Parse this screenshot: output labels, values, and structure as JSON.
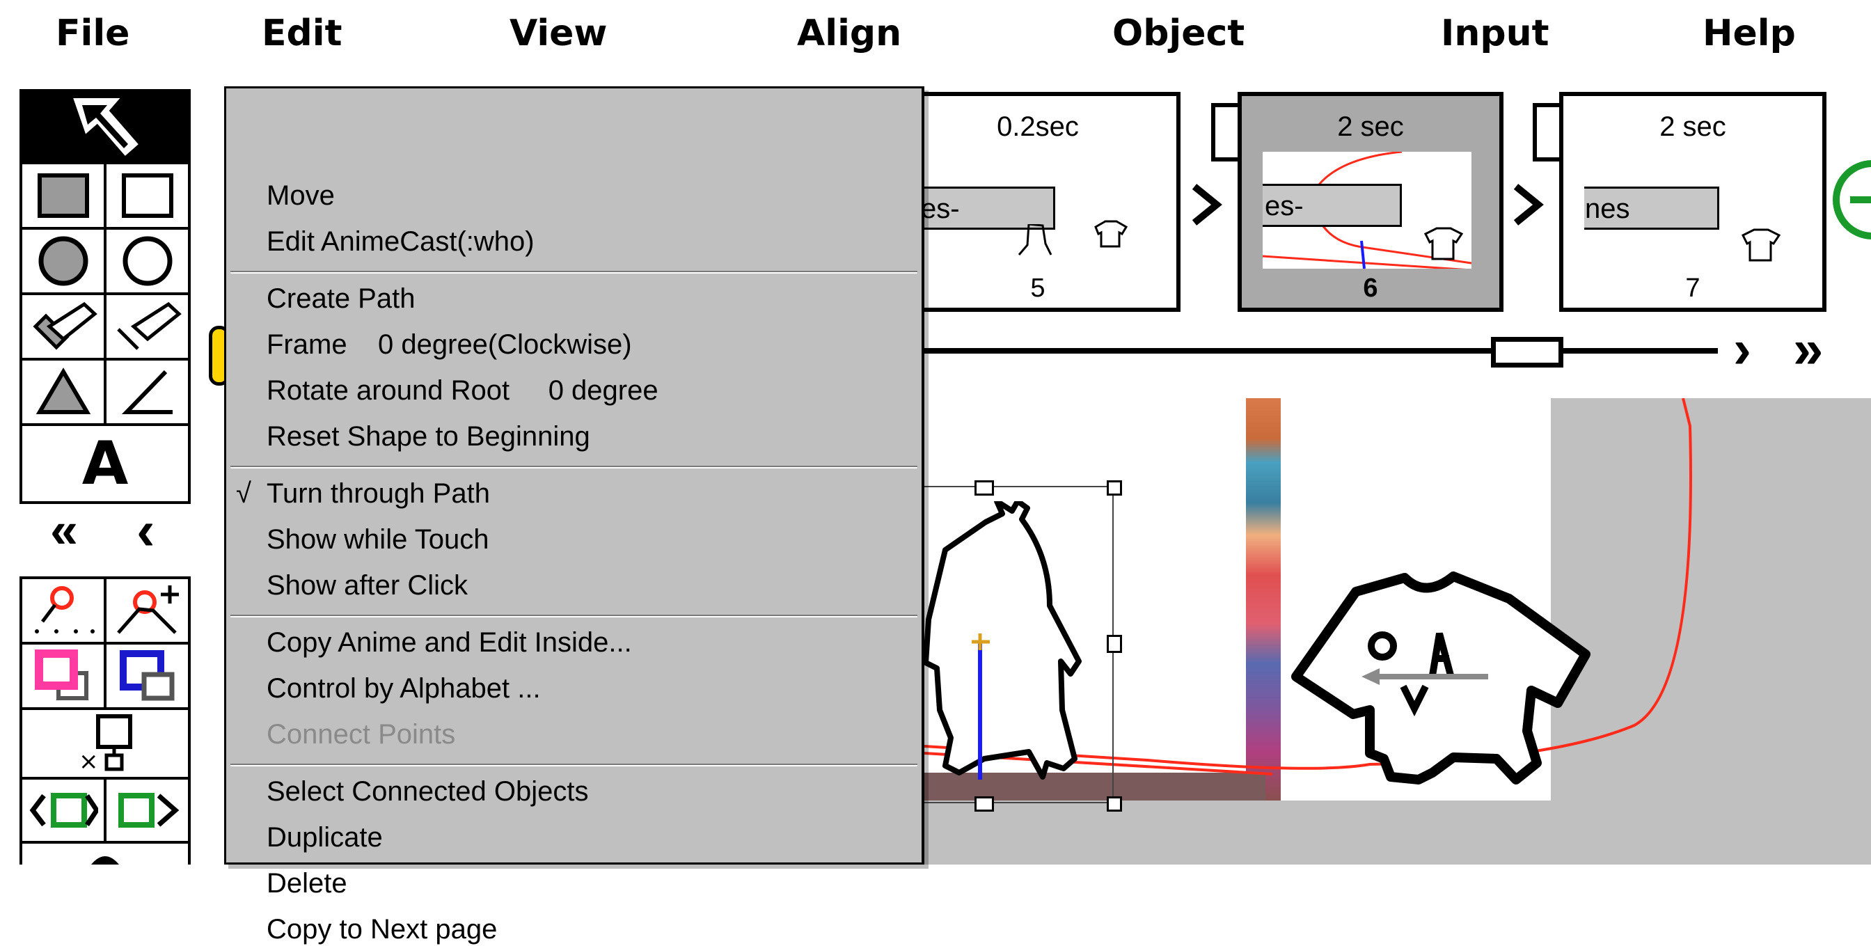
{
  "menubar": {
    "items": [
      "File",
      "Edit",
      "View",
      "Align",
      "Object",
      "Input",
      "Help"
    ]
  },
  "palette": {
    "nav_prev_all": "«",
    "nav_prev": "‹",
    "text_tool_label": "A"
  },
  "frames": [
    {
      "time": "0.2sec",
      "label": "es-",
      "number": "5",
      "active": false
    },
    {
      "time": "2 sec",
      "label": "es-",
      "number": "6",
      "active": true
    },
    {
      "time": "2 sec",
      "label": "nes",
      "number": "7",
      "active": false
    }
  ],
  "timeline": {
    "next": "›",
    "next_all": "»"
  },
  "dropdown": {
    "items": [
      "Move",
      "Edit AnimeCast(:who)",
      "Create Path",
      "Frame    0 degree(Clockwise)",
      "Rotate around Root     0 degree",
      "Reset Shape to Beginning",
      "Turn through Path",
      "Show while Touch",
      "Show after Click",
      "Copy Anime and Edit Inside...",
      "Control by Alphabet ...",
      "Connect Points",
      "Select Connected Objects",
      "Duplicate",
      "Delete",
      "Copy to Next page"
    ],
    "check_mark": "√"
  },
  "colors": {
    "menu_bg": "#c0c0c0",
    "accent_red": "#ff2a1a",
    "path_blue": "#1a1aff",
    "add_green": "#1a9a2a"
  }
}
